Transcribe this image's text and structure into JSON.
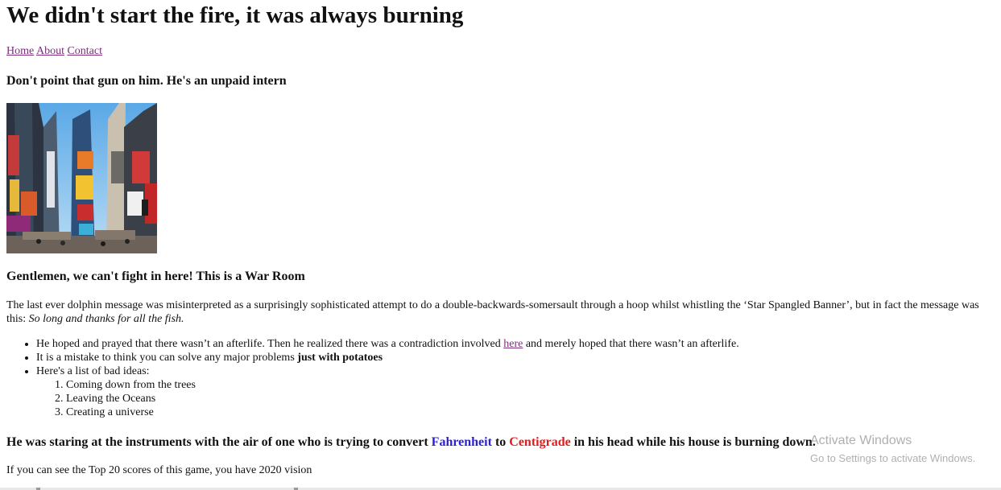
{
  "header": {
    "title": "We didn't start the fire, it was always burning"
  },
  "nav": {
    "items": [
      "Home",
      "About",
      "Contact"
    ]
  },
  "section1": {
    "heading": "Don't point that gun on him. He's an unpaid intern"
  },
  "section2": {
    "heading": "Gentlemen, we can't fight in here! This is a War Room",
    "paragraph_text": "The last ever dolphin message was misinterpreted as a surprisingly sophisticated attempt to do a double-backwards-somersault through a hoop whilst whistling the ‘Star Spangled Banner’, but in fact the message was this: ",
    "paragraph_italic": "So long and thanks for all the fish.",
    "bullets": {
      "item1_before": "He hoped and prayed that there wasn’t an afterlife. Then he realized there was a contradiction involved ",
      "item1_link": "here",
      "item1_after": " and merely hoped that there wasn’t an afterlife.",
      "item2_before": "It is a mistake to think you can solve any major problems ",
      "item2_bold": "just with potatoes",
      "item3": "Here's a list of bad ideas:",
      "bad_ideas": [
        "Coming down from the trees",
        "Leaving the Oceans",
        "Creating a universe"
      ]
    }
  },
  "section3": {
    "heading_part1": "He was staring at the instruments with the air of one who is trying to convert ",
    "fahrenheit": "Fahrenheit",
    "heading_part2": " to ",
    "centigrade": "Centigrade",
    "heading_part3": " in his head while his house is burning down.",
    "footer_text": "If you can see the Top 20 scores of this game, you have 2020 vision"
  },
  "watermark": {
    "line1": "Activate Windows",
    "line2": "Go to Settings to activate Windows."
  },
  "colors": {
    "visited_link": "#7b2d7b",
    "fahrenheit": "#2a1fd6",
    "centigrade": "#e01b1b"
  }
}
